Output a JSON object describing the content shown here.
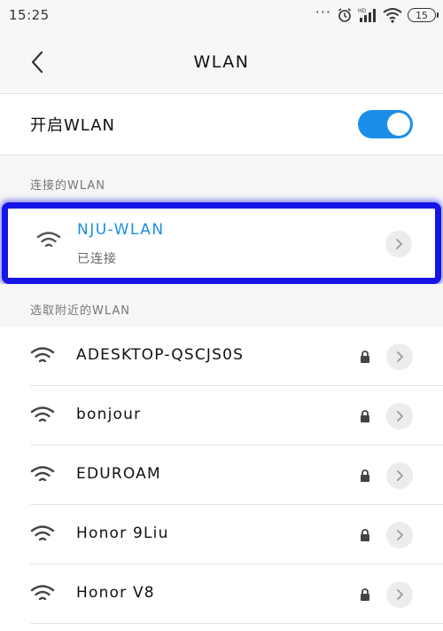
{
  "status_bar": {
    "time": "15:25",
    "battery": "15",
    "icons": [
      "more-dots-icon",
      "alarm-icon",
      "hd-signal-icon",
      "wifi-status-icon",
      "battery-icon"
    ]
  },
  "header": {
    "title": "WLAN",
    "back_icon": "back-chevron-icon"
  },
  "wlan_toggle": {
    "label": "开启WLAN",
    "state": "on",
    "color": "#1a8ee8"
  },
  "connected_section": {
    "title": "连接的WLAN",
    "network": {
      "name": "NJU-WLAN",
      "status": "已连接",
      "icon": "wifi-icon"
    }
  },
  "nearby_section": {
    "title": "选取附近的WLAN",
    "networks": [
      {
        "name": "ADESKTOP-QSCJS0S",
        "locked": true
      },
      {
        "name": "bonjour",
        "locked": true
      },
      {
        "name": "EDUROAM",
        "locked": true
      },
      {
        "name": "Honor 9Liu",
        "locked": true
      },
      {
        "name": "Honor V8",
        "locked": true
      }
    ]
  },
  "colors": {
    "accent": "#1a8ee8",
    "highlight_border": "#1515e6"
  }
}
